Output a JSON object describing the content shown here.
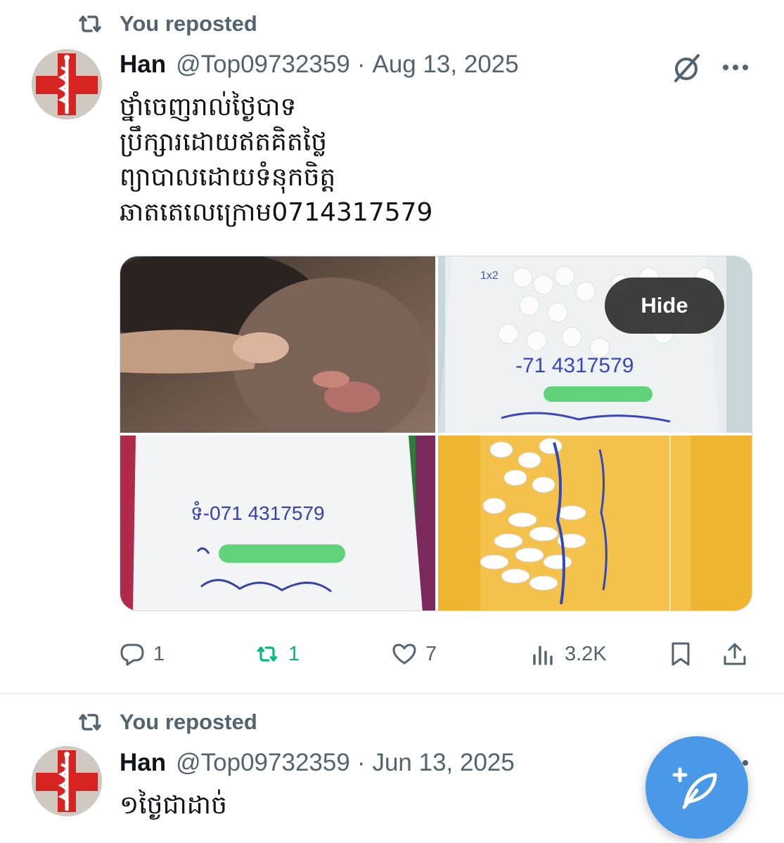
{
  "posts": [
    {
      "repost_label": "You reposted",
      "author_name": "Han",
      "author_handle": "@Top09732359",
      "separator": "·",
      "date": "Aug 13, 2025",
      "text_lines": [
        "ថ្នាំចេញរាល់ថ្ងៃបាទ",
        "ប្រឹក្សារដោយឥតគិតថ្លៃ",
        "ព្យាបាលដោយទំនុកចិត្ត",
        "ឆាតតេលេក្រោម0714317579"
      ],
      "media_hide_label": "Hide",
      "photo_labels": {
        "bag_top": "1x2",
        "bag_phone": "-71 4317579",
        "envelope_phone": "ទំ-071 4317579"
      },
      "stats": {
        "replies": "1",
        "reposts": "1",
        "likes": "7",
        "views": "3.2K"
      }
    },
    {
      "repost_label": "You reposted",
      "author_name": "Han",
      "author_handle": "@Top09732359",
      "separator": "·",
      "date": "Jun 13, 2025",
      "text_lines": [
        "១ថ្ងៃជាដាច់"
      ]
    }
  ],
  "colors": {
    "text_primary": "#0f1419",
    "text_secondary": "#536471",
    "repost_green": "#00ba7c",
    "fab_blue": "#4a99e9"
  },
  "icons": {
    "repost": "repost-icon",
    "grok": "grok-icon",
    "more": "more-icon",
    "reply": "reply-icon",
    "like": "heart-icon",
    "views": "views-icon",
    "bookmark": "bookmark-icon",
    "share": "share-icon",
    "compose": "compose-icon"
  }
}
